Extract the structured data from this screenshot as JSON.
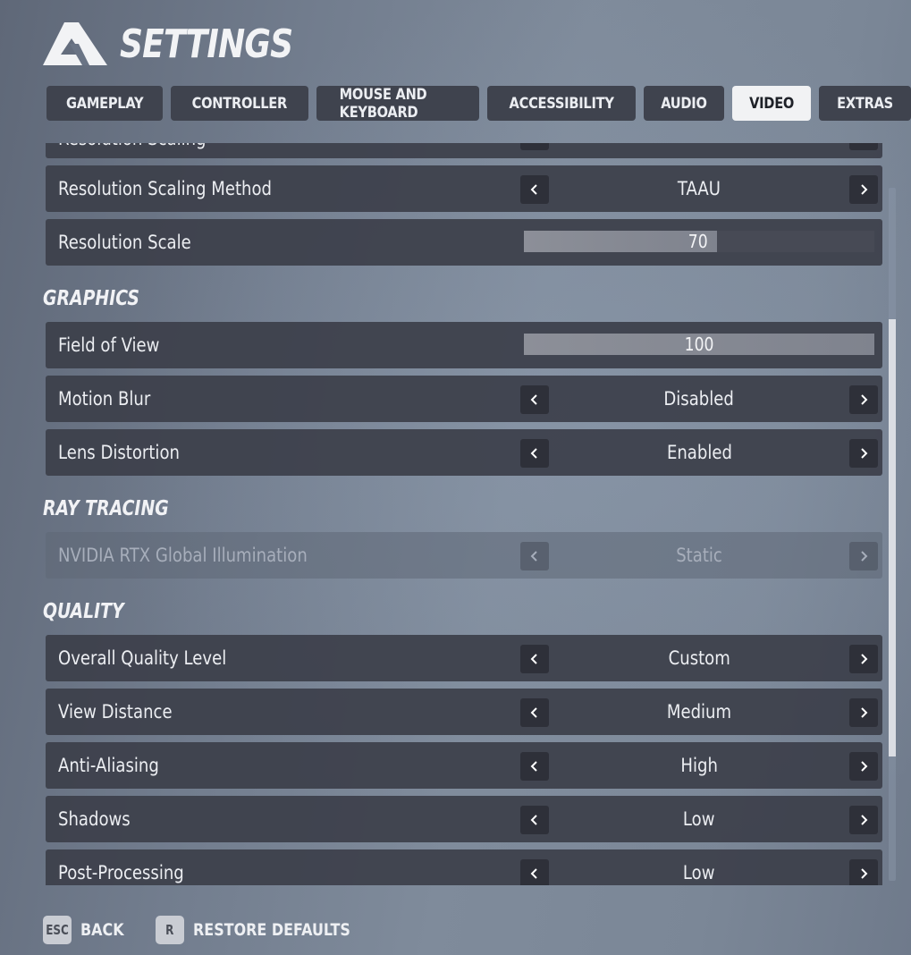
{
  "header": {
    "title": "SETTINGS",
    "logo_icon": "game-logo-icon"
  },
  "tabs": [
    {
      "label": "GAMEPLAY",
      "active": false
    },
    {
      "label": "CONTROLLER",
      "active": false
    },
    {
      "label": "MOUSE AND KEYBOARD",
      "active": false
    },
    {
      "label": "ACCESSIBILITY",
      "active": false
    },
    {
      "label": "AUDIO",
      "active": false
    },
    {
      "label": "VIDEO",
      "active": true
    },
    {
      "label": "EXTRAS",
      "active": false
    }
  ],
  "settings": {
    "clipped_top": {
      "label": "Resolution Scaling",
      "value": ""
    },
    "resolution_scaling_method": {
      "label": "Resolution Scaling Method",
      "value": "TAAU"
    },
    "resolution_scale": {
      "label": "Resolution Scale",
      "value": "70",
      "fill_fraction": 0.55
    },
    "graphics_header": "GRAPHICS",
    "field_of_view": {
      "label": "Field of View",
      "value": "100",
      "fill_fraction": 1.0
    },
    "motion_blur": {
      "label": "Motion Blur",
      "value": "Disabled"
    },
    "lens_distortion": {
      "label": "Lens Distortion",
      "value": "Enabled"
    },
    "ray_tracing_header": "RAY TRACING",
    "rtx_gi": {
      "label": "NVIDIA RTX Global Illumination",
      "value": "Static",
      "disabled": true
    },
    "quality_header": "QUALITY",
    "overall_quality": {
      "label": "Overall Quality Level",
      "value": "Custom"
    },
    "view_distance": {
      "label": "View Distance",
      "value": "Medium"
    },
    "anti_aliasing": {
      "label": "Anti-Aliasing",
      "value": "High"
    },
    "shadows": {
      "label": "Shadows",
      "value": "Low"
    },
    "post_processing": {
      "label": "Post-Processing",
      "value": "Low"
    }
  },
  "scrollbar": {
    "thumb_start_fraction": 0.19,
    "thumb_size_fraction": 0.63
  },
  "footer": {
    "back": {
      "key": "ESC",
      "label": "BACK"
    },
    "restore": {
      "key": "R",
      "label": "RESTORE DEFAULTS"
    }
  },
  "icons": {
    "left": "chevron-left-icon",
    "right": "chevron-right-icon"
  }
}
